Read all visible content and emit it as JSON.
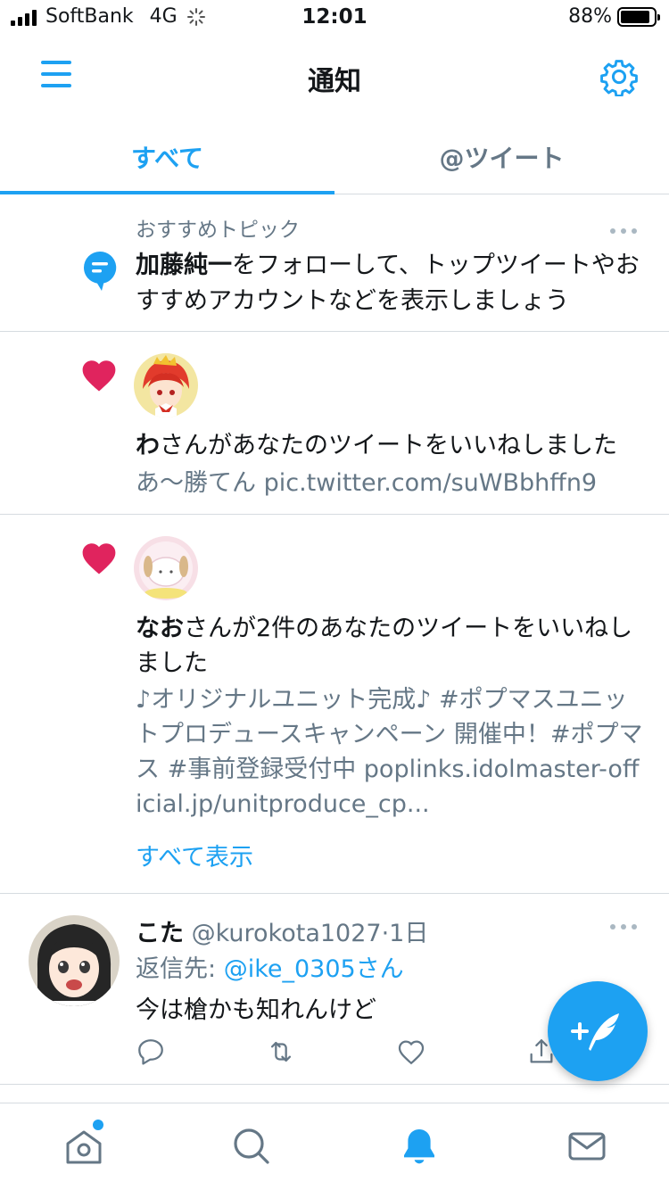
{
  "status_bar": {
    "carrier": "SoftBank",
    "network": "4G",
    "time": "12:01",
    "battery": "88%"
  },
  "header": {
    "title": "通知",
    "menu_icon": "hamburger-menu-icon",
    "settings_icon": "gear-icon"
  },
  "tabs": [
    {
      "label": "すべて",
      "active": true
    },
    {
      "label": "@ツイート",
      "active": false
    }
  ],
  "topic": {
    "label": "おすすめトピック",
    "name": "加藤純一",
    "text": "をフォローして、トップツイートやおすすめアカウントなどを表示しましょう"
  },
  "notifications": [
    {
      "user": "わ",
      "action": "さんがあなたのツイートをいいねしました",
      "snippet": "あ〜勝てん pic.twitter.com/suWBbhffn9"
    },
    {
      "user": "なお",
      "action": "さんが2件のあなたのツイートをいいねしました",
      "snippet": "♪オリジナルユニット完成♪ #ポプマスユニットプロデュースキャンペーン 開催中！#ポプマス #事前登録受付中 poplinks.idolmaster-official.jp/unitproduce_cp...",
      "show_all": "すべて表示"
    }
  ],
  "tweet": {
    "name": "こた",
    "handle": "@kurokota1027",
    "time": "·1日",
    "reply_label": "返信先: ",
    "reply_to": "@ike_0305さん",
    "text": "今は槍かも知れんけど"
  },
  "colors": {
    "accent": "#1da1f2",
    "like": "#e0245e",
    "secondary_text": "#657786"
  }
}
